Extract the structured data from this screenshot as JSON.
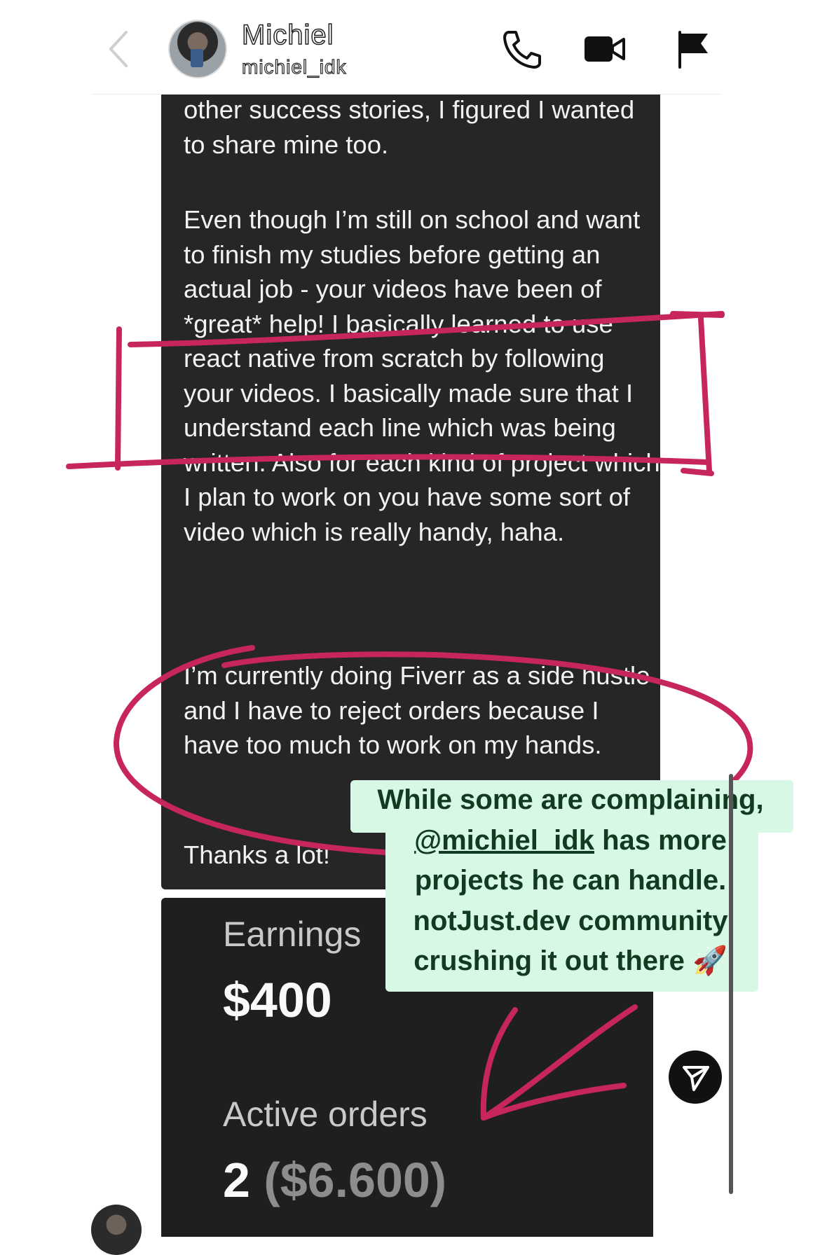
{
  "header": {
    "display_name": "Michiel",
    "username": "michiel_idk",
    "icons": [
      "back-icon",
      "phone-icon",
      "video-icon",
      "flag-icon"
    ]
  },
  "message": {
    "p1": "other success stories, I figured I wanted to share mine too.",
    "p2": "Even though I’m still on school and want to finish my studies before getting an actual job - your videos have been of *great* help! I basically learned to use react native from scratch by following your videos. I basically made sure that I understand each line which was being written. Also for each kind of project which I plan to work on you have some sort of video which is really handy, haha.",
    "p3": "I’m currently doing Fiverr as a side hustle and I have to reject orders because I have too much to work on my hands.",
    "p4": "Thanks a lot!"
  },
  "card": {
    "earnings_label": "Earnings",
    "earnings_value": "$400",
    "orders_label": "Active orders",
    "orders_count": "2",
    "orders_amount": "($6.600)"
  },
  "sticker": {
    "line1": "While some are complaining,",
    "mention": "@michiel_idk",
    "line2_rest": " has more",
    "line3": "projects he can handle.",
    "line4": "notJust.dev community",
    "line5": "crushing it out there",
    "emoji": "🚀"
  },
  "colors": {
    "bubble": "#262626",
    "sticker_bg": "#d7f8e4",
    "sticker_text": "#123a20",
    "annotation": "#c7255e"
  }
}
